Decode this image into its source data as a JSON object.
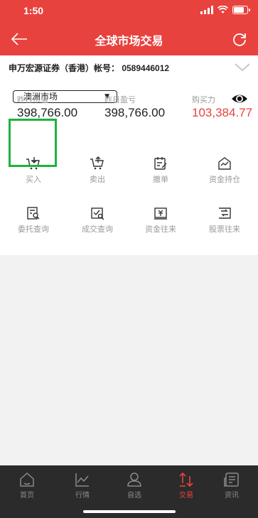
{
  "status_bar": {
    "time": "1:50"
  },
  "nav": {
    "title": "全球市场交易"
  },
  "account": {
    "label": "申万宏源证券（香港）帐号： 0589446012"
  },
  "market": {
    "selected": "澳洲市场"
  },
  "metrics": [
    {
      "label": "昨日市值",
      "value": "398,766.00"
    },
    {
      "label": "昨日盈亏",
      "value": "398,766.00"
    },
    {
      "label": "购买力",
      "value": "103,384.77"
    }
  ],
  "actions": [
    {
      "label": "买入",
      "icon": "cart-in-icon"
    },
    {
      "label": "卖出",
      "icon": "cart-out-icon"
    },
    {
      "label": "撤单",
      "icon": "cancel-order-icon"
    },
    {
      "label": "资金持仓",
      "icon": "position-icon"
    },
    {
      "label": "委托查询",
      "icon": "order-query-icon"
    },
    {
      "label": "成交查询",
      "icon": "trade-query-icon"
    },
    {
      "label": "资金往来",
      "icon": "fund-transfer-icon"
    },
    {
      "label": "股票往来",
      "icon": "stock-transfer-icon"
    }
  ],
  "tabbar": [
    {
      "label": "首页",
      "icon": "home-icon"
    },
    {
      "label": "行情",
      "icon": "chart-icon"
    },
    {
      "label": "自选",
      "icon": "user-icon"
    },
    {
      "label": "交易",
      "icon": "trade-icon",
      "active": true
    },
    {
      "label": "资讯",
      "icon": "news-icon"
    }
  ],
  "colors": {
    "brand": "#e8423f",
    "highlight": "#1fb23f",
    "tabbar": "#2b2b2b"
  }
}
